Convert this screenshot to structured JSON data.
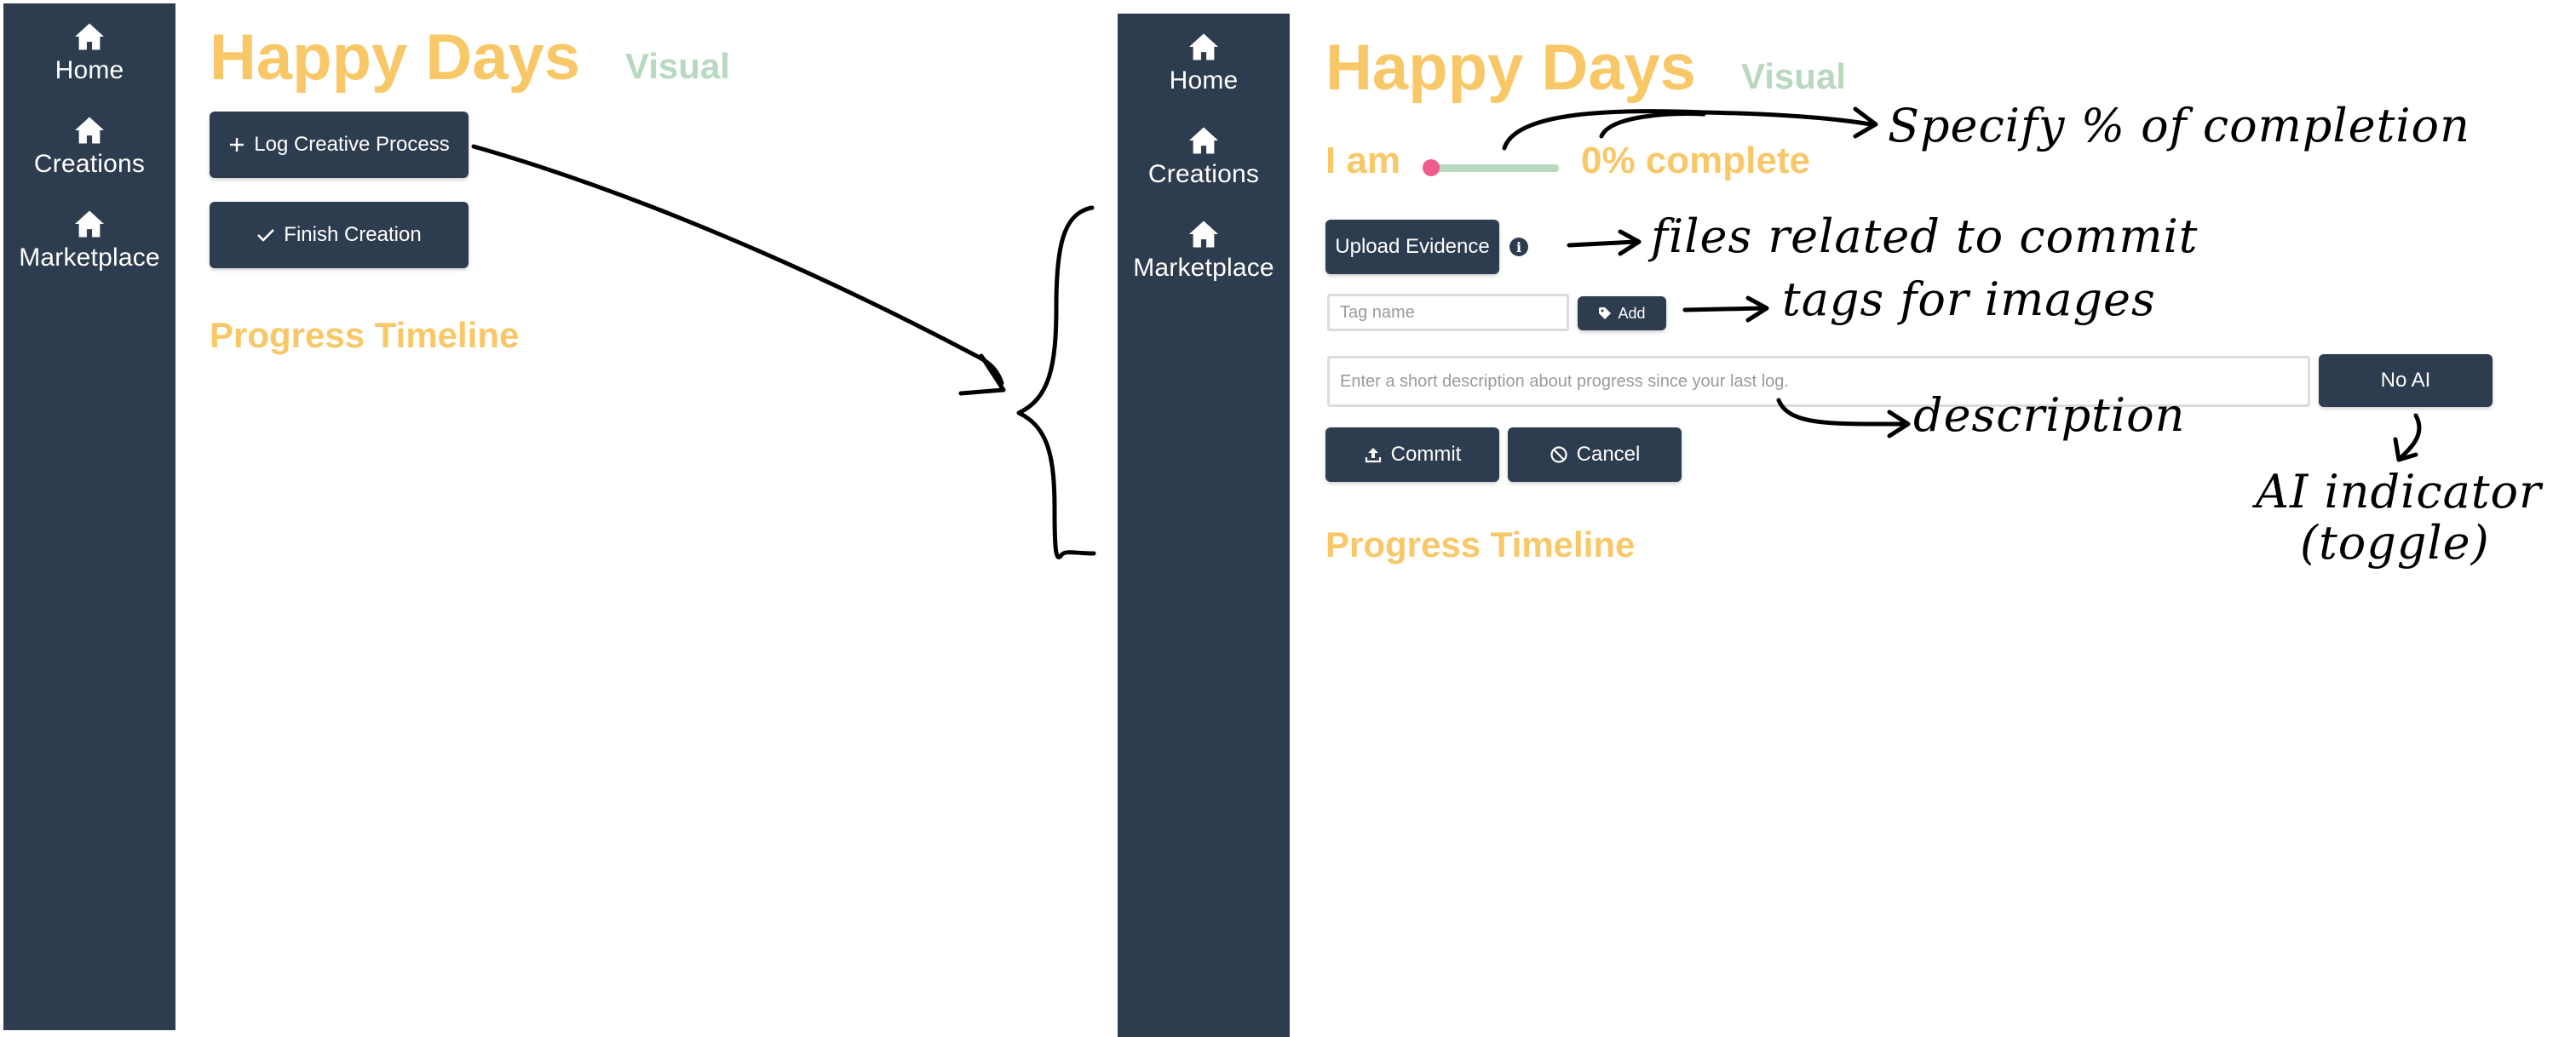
{
  "nav": {
    "items": [
      {
        "label": "Home",
        "icon": "home-icon"
      },
      {
        "label": "Creations",
        "icon": "home-icon"
      },
      {
        "label": "Marketplace",
        "icon": "home-icon"
      }
    ]
  },
  "before": {
    "title": "Happy Days",
    "subtitle": "Visual",
    "log_button": "Log Creative Process",
    "finish_button": "Finish Creation",
    "timeline_heading": "Progress Timeline"
  },
  "after": {
    "title": "Happy Days",
    "subtitle": "Visual",
    "progress": {
      "prefix": "I am",
      "value_text": "0% complete",
      "percent": 0
    },
    "upload_button": "Upload Evidence",
    "info_icon": "i",
    "tag_placeholder": "Tag name",
    "tag_add_button": "Add",
    "description_placeholder": "Enter a short description about progress since your last log.",
    "ai_toggle": "No AI",
    "commit_button": "Commit",
    "cancel_button": "Cancel",
    "timeline_heading": "Progress Timeline"
  },
  "annotations": {
    "completion": "Specify % of completion",
    "files": "files related to commit",
    "tags": "tags for images",
    "description": "description",
    "ai_line1": "AI indicator",
    "ai_line2": "(toggle)"
  },
  "colors": {
    "sidebar": "#2e3c4f",
    "title": "#f8c868",
    "subtitle": "#b8d8bf",
    "slider_thumb": "#ef5c8d"
  }
}
